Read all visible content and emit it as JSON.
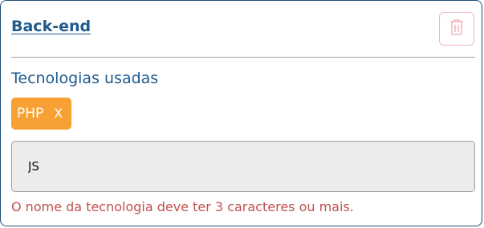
{
  "card": {
    "title": "Back-end",
    "delete_icon": "trash-icon"
  },
  "technologies": {
    "label": "Tecnologias usadas",
    "tags": [
      {
        "name": "PHP",
        "remove_label": "X"
      }
    ],
    "input_value": "JS",
    "error_message": "O nome da tecnologia deve ter 3 caracteres ou mais."
  },
  "colors": {
    "primary": "#1e5a8e",
    "tag_background": "#f7a034",
    "error": "#c0504d",
    "delete_border": "#f2b8bf"
  }
}
